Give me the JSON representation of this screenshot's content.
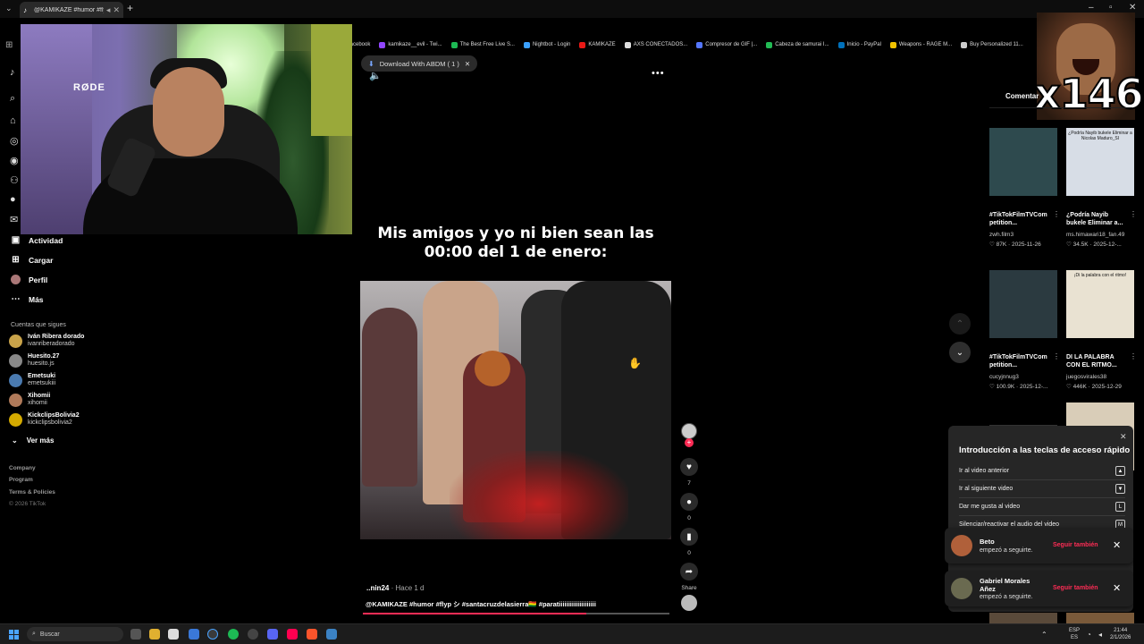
{
  "browser": {
    "tab_title": "@KAMIKAZE #humor #flyp",
    "bookmarks": [
      {
        "label": "facebook",
        "color": "#1877f2"
      },
      {
        "label": "kamikaze__evil - Twi...",
        "color": "#9146ff"
      },
      {
        "label": "The Best Free Live S...",
        "color": "#1db954"
      },
      {
        "label": "Nightbot - Login",
        "color": "#3aa0ff"
      },
      {
        "label": "KAMIKAZE",
        "color": "#e91916"
      },
      {
        "label": "AXS CONECTADOS...",
        "color": "#dddddd"
      },
      {
        "label": "Compresor de GIF |...",
        "color": "#5577ff"
      },
      {
        "label": "Cabeza de samurai I...",
        "color": "#22bb55"
      },
      {
        "label": "Inicio - PayPal",
        "color": "#0070ba"
      },
      {
        "label": "Weapons - RAGE M...",
        "color": "#f2c200"
      },
      {
        "label": "Buy Personalized 11...",
        "color": "#cccccc"
      }
    ]
  },
  "download_pill": {
    "label": "Download With ABDM ( 1 )"
  },
  "sidebar": {
    "nav": [
      {
        "label": "Actividad",
        "icon": "inbox-icon"
      },
      {
        "label": "Cargar",
        "icon": "upload-icon"
      },
      {
        "label": "Perfil",
        "icon": "profile-icon"
      },
      {
        "label": "Más",
        "icon": "more-icon"
      }
    ],
    "following_title": "Cuentas que sigues",
    "following": [
      {
        "name": "Iván Ribera dorado",
        "handle": "ivanriberadorado",
        "color": "#c9a34a"
      },
      {
        "name": "Huesito.27",
        "handle": "huesito.js",
        "color": "#888888"
      },
      {
        "name": "Emetsuki",
        "handle": "emetsukiii",
        "color": "#4a7ab0"
      },
      {
        "name": "Xihomii",
        "handle": "xihomii",
        "color": "#b07a5a"
      },
      {
        "name": "KickclipsBolivia2",
        "handle": "kickclipsbolivia2",
        "color": "#d4aa00"
      }
    ],
    "ver_mas": "Ver más",
    "footer": [
      "Company",
      "Program",
      "Terms & Policies",
      "© 2026 TikTok"
    ]
  },
  "webcam": {
    "mic_brand": "RØDE"
  },
  "reaction": {
    "multiplier": "x146"
  },
  "video": {
    "caption": "Mis amigos y yo ni bien sean las 00:00 del 1 de enero:",
    "creator": "..nin24",
    "time_ago": "Hace 1 d",
    "description": "@KAMIKAZE #humor #flyp シ #santacruzdelasierra🇧🇴 #paratiiiiiiiiiiiiiiiiiiii",
    "progress": 0.73
  },
  "actions": {
    "likes": "7",
    "comments": "0",
    "saves": "0",
    "share_label": "Share"
  },
  "right_panel": {
    "tab": "Comentar",
    "videos": [
      {
        "title": "#TikTokFilmTVCom petition...",
        "user": "zwh.film3",
        "views": "87K",
        "date": "2025-11-26",
        "thumb": "#2e4a4e",
        "overlay": ""
      },
      {
        "title": "¿Podría Nayib bukele Eliminar a...",
        "user": "ms.himawari18_fan.49",
        "views": "34.5K",
        "date": "2025-12-...",
        "thumb": "#d7dde6",
        "overlay": "¿Podría Nayib bukele Eliminar a Nicolas Maduro_SI"
      },
      {
        "title": "#TikTokFilmTVCom petition...",
        "user": "cucyjnnug3",
        "views": "100.9K",
        "date": "2025-12-...",
        "thumb": "#2b3a40",
        "overlay": ""
      },
      {
        "title": "DI LA PALABRA CON EL RITMO...",
        "user": "juegosvirales38",
        "views": "446K",
        "date": "2025-12-29",
        "thumb": "#e9e2d2",
        "overlay": "¡Di la palabra con el ritmo!"
      }
    ]
  },
  "shortcuts": {
    "title": "Introducción a las teclas de acceso rápido",
    "items": [
      {
        "label": "Ir al video anterior",
        "key": "▲"
      },
      {
        "label": "Ir al siguiente video",
        "key": "▼"
      },
      {
        "label": "Dar me gusta al video",
        "key": "L"
      },
      {
        "label": "Silenciar/reactivar el audio del video",
        "key": "M"
      }
    ]
  },
  "notifications": [
    {
      "name": "Beto",
      "text": "empezó a seguirte.",
      "action": "Seguir también",
      "color": "#b0603a"
    },
    {
      "name": "Gabriel Morales Añez",
      "text": "empezó a seguirte.",
      "action": "Seguir también",
      "color": "#6a6a50"
    }
  ],
  "taskbar": {
    "search_placeholder": "Buscar",
    "lang": "ESP",
    "lang2": "ES",
    "time": "21:44",
    "date": "2/1/2026"
  }
}
